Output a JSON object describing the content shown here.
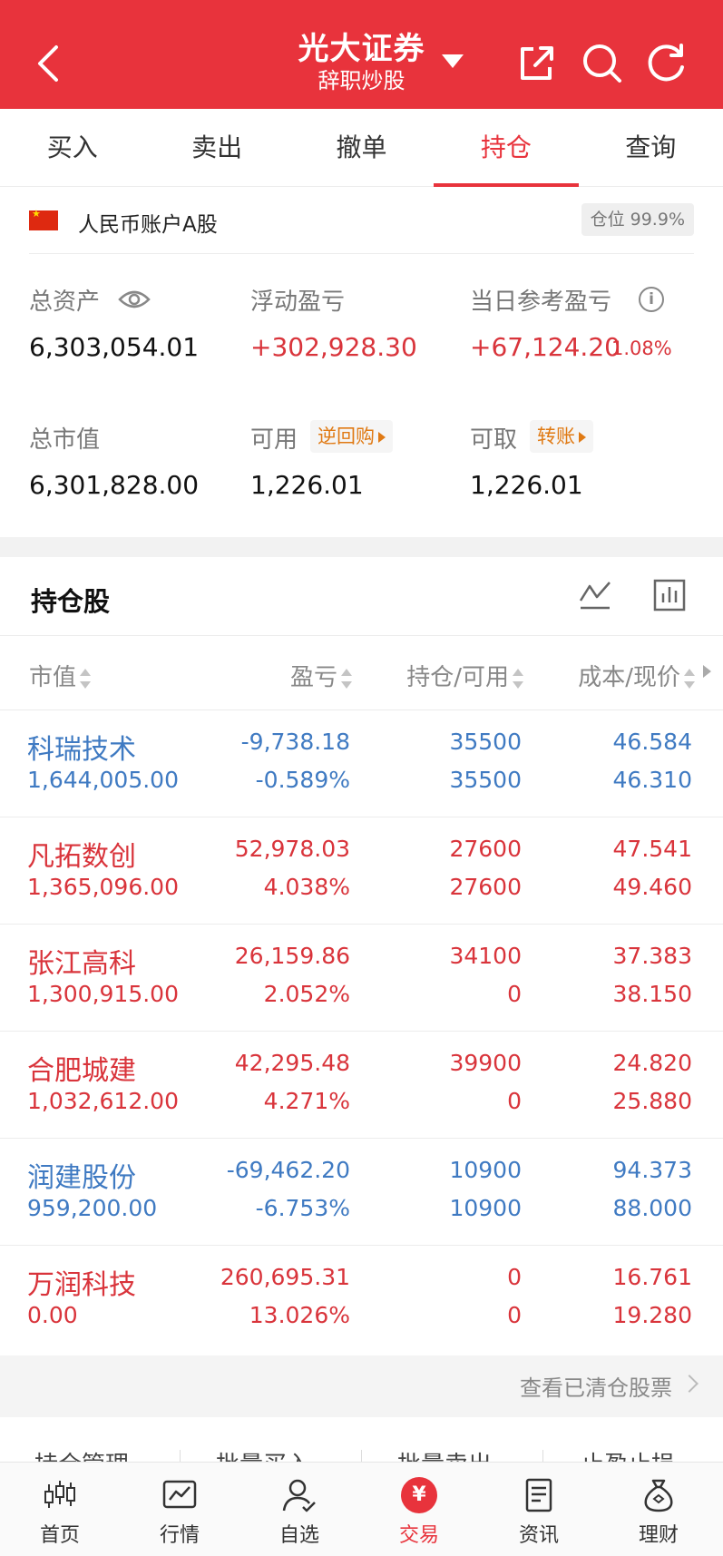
{
  "header": {
    "title": "光大证券",
    "subtitle": "辞职炒股",
    "icons": [
      "back-icon",
      "dropdown-caret-icon",
      "share-icon",
      "search-icon",
      "refresh-icon"
    ],
    "bg_color": "#e8333c"
  },
  "tabs": [
    {
      "label": "买入",
      "active": false
    },
    {
      "label": "卖出",
      "active": false
    },
    {
      "label": "撤单",
      "active": false
    },
    {
      "label": "持仓",
      "active": true
    },
    {
      "label": "查询",
      "active": false
    }
  ],
  "account": {
    "label": "人民币账户A股",
    "position_badge": "仓位 99.9%"
  },
  "summary": {
    "total_assets_label": "总资产",
    "total_assets": "6,303,054.01",
    "float_pl_label": "浮动盈亏",
    "float_pl": "+302,928.30",
    "day_pl_label": "当日参考盈亏",
    "day_pl": "+67,124.20",
    "day_pl_pct": "1.08%",
    "market_value_label": "总市值",
    "market_value": "6,301,828.00",
    "available_label": "可用",
    "available_chip": "逆回购",
    "available": "1,226.01",
    "withdrawable_label": "可取",
    "withdrawable_chip": "转账",
    "withdrawable": "1,226.01"
  },
  "holdings": {
    "title": "持仓股",
    "columns": [
      "市值",
      "盈亏",
      "持仓/可用",
      "成本/现价"
    ],
    "rows": [
      {
        "name": "科瑞技术",
        "market_value": "1,644,005.00",
        "pl": "-9,738.18",
        "pl_pct": "-0.589%",
        "hold": "35500",
        "avail": "35500",
        "cost": "46.584",
        "price": "46.310",
        "trend": "down"
      },
      {
        "name": "凡拓数创",
        "market_value": "1,365,096.00",
        "pl": "52,978.03",
        "pl_pct": "4.038%",
        "hold": "27600",
        "avail": "27600",
        "cost": "47.541",
        "price": "49.460",
        "trend": "up"
      },
      {
        "name": "张江高科",
        "market_value": "1,300,915.00",
        "pl": "26,159.86",
        "pl_pct": "2.052%",
        "hold": "34100",
        "avail": "0",
        "cost": "37.383",
        "price": "38.150",
        "trend": "up"
      },
      {
        "name": "合肥城建",
        "market_value": "1,032,612.00",
        "pl": "42,295.48",
        "pl_pct": "4.271%",
        "hold": "39900",
        "avail": "0",
        "cost": "24.820",
        "price": "25.880",
        "trend": "up"
      },
      {
        "name": "润建股份",
        "market_value": "959,200.00",
        "pl": "-69,462.20",
        "pl_pct": "-6.753%",
        "hold": "10900",
        "avail": "10900",
        "cost": "94.373",
        "price": "88.000",
        "trend": "down"
      },
      {
        "name": "万润科技",
        "market_value": "0.00",
        "pl": "260,695.31",
        "pl_pct": "13.026%",
        "hold": "0",
        "avail": "0",
        "cost": "16.761",
        "price": "19.280",
        "trend": "up"
      }
    ]
  },
  "cleared_link": "查看已清仓股票",
  "management": [
    "持仓管理",
    "批量买入",
    "批量卖出",
    "止盈止损"
  ],
  "tabbar": [
    {
      "label": "首页",
      "icon": "candlestick-icon",
      "active": false
    },
    {
      "label": "行情",
      "icon": "chart-icon",
      "active": false
    },
    {
      "label": "自选",
      "icon": "user-check-icon",
      "active": false
    },
    {
      "label": "交易",
      "icon": "yuan-icon",
      "active": true,
      "glyph": "¥"
    },
    {
      "label": "资讯",
      "icon": "news-icon",
      "active": false
    },
    {
      "label": "理财",
      "icon": "money-bag-icon",
      "active": false
    }
  ],
  "colors": {
    "up": "#d9343b",
    "down": "#3f7ac2",
    "accent": "#e8333c",
    "chip": "#e07a14"
  }
}
